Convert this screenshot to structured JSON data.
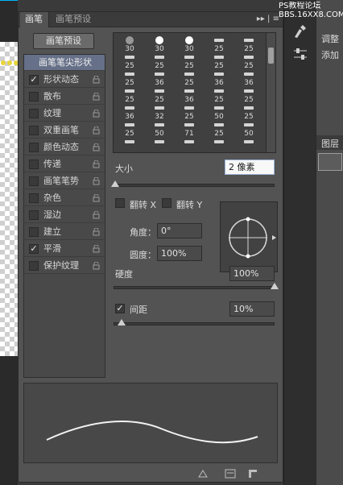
{
  "tabs": {
    "brush": "画笔",
    "brush_presets": "画笔预设"
  },
  "panel_menu_glyph": "▸▸ | ≡",
  "preset_button_label": "画笔预设",
  "options": [
    {
      "label": "画笔笔尖形状",
      "checked": null,
      "active": true
    },
    {
      "label": "形状动态",
      "checked": true
    },
    {
      "label": "散布",
      "checked": false
    },
    {
      "label": "纹理",
      "checked": false
    },
    {
      "label": "双重画笔",
      "checked": false
    },
    {
      "label": "颜色动态",
      "checked": false
    },
    {
      "label": "传递",
      "checked": false
    },
    {
      "label": "画笔笔势",
      "checked": false
    },
    {
      "label": "杂色",
      "checked": false
    },
    {
      "label": "湿边",
      "checked": false
    },
    {
      "label": "建立",
      "checked": false
    },
    {
      "label": "平滑",
      "checked": true
    },
    {
      "label": "保护纹理",
      "checked": false
    }
  ],
  "brush_tips": {
    "rows": [
      [
        "30",
        "30",
        "30",
        "25",
        "25"
      ],
      [
        "25",
        "25",
        "25",
        "25",
        "25"
      ],
      [
        "25",
        "36",
        "25",
        "36",
        "36"
      ],
      [
        "25",
        "25",
        "36",
        "25",
        "25"
      ],
      [
        "36",
        "32",
        "25",
        "50",
        "25"
      ],
      [
        "25",
        "50",
        "71",
        "25",
        "50"
      ],
      [
        "",
        "",
        "",
        "",
        ""
      ]
    ]
  },
  "size": {
    "label": "大小",
    "value": "2 像素"
  },
  "flip": {
    "x_label": "翻转 X",
    "y_label": "翻转 Y"
  },
  "angle": {
    "label": "角度：",
    "value": "0°"
  },
  "roundness": {
    "label": "圆度：",
    "value": "100%"
  },
  "hardness": {
    "label": "硬度",
    "value": "100%"
  },
  "spacing": {
    "label": "间距",
    "value": "10%",
    "checked": true
  },
  "right_panel": {
    "adjust": "调整",
    "add": "添加",
    "layers": "图层"
  },
  "watermark": {
    "line1": "PS教程论坛",
    "line2": "BBS.16XX8.COM"
  }
}
